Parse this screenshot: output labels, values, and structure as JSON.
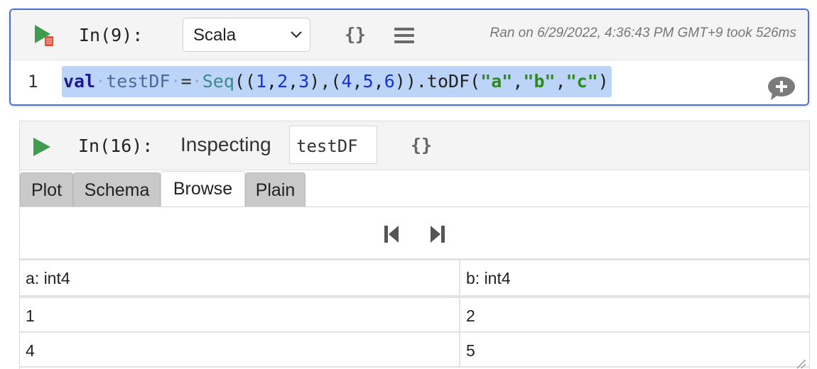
{
  "cell1": {
    "prompt": "In(9):",
    "language": "Scala",
    "braces": "{}",
    "run_info": "Ran on 6/29/2022, 4:36:43 PM GMT+9 took 526ms",
    "line_number": "1",
    "code_tokens": [
      {
        "t": "val",
        "c": "kw"
      },
      {
        "t": "·",
        "c": "ws"
      },
      {
        "t": "testDF",
        "c": "id"
      },
      {
        "t": "·",
        "c": "ws"
      },
      {
        "t": "=",
        "c": "op"
      },
      {
        "t": "·",
        "c": "ws"
      },
      {
        "t": "Seq",
        "c": "ty"
      },
      {
        "t": "((",
        "c": "p"
      },
      {
        "t": "1",
        "c": "num"
      },
      {
        "t": ",",
        "c": "p"
      },
      {
        "t": "2",
        "c": "num"
      },
      {
        "t": ",",
        "c": "p"
      },
      {
        "t": "3",
        "c": "num"
      },
      {
        "t": "),(",
        "c": "p"
      },
      {
        "t": "4",
        "c": "num"
      },
      {
        "t": ",",
        "c": "p"
      },
      {
        "t": "5",
        "c": "num"
      },
      {
        "t": ",",
        "c": "p"
      },
      {
        "t": "6",
        "c": "num"
      },
      {
        "t": ")).toDF(",
        "c": "p"
      },
      {
        "t": "\"a\"",
        "c": "str"
      },
      {
        "t": ",",
        "c": "p"
      },
      {
        "t": "\"b\"",
        "c": "str"
      },
      {
        "t": ",",
        "c": "p"
      },
      {
        "t": "\"c\"",
        "c": "str"
      },
      {
        "t": ")",
        "c": "p"
      }
    ]
  },
  "cell2": {
    "prompt": "In(16):",
    "inspect_label": "Inspecting",
    "inspect_value": "testDF",
    "braces": "{}",
    "tabs": [
      {
        "label": "Plot",
        "active": false
      },
      {
        "label": "Schema",
        "active": false
      },
      {
        "label": "Browse",
        "active": true
      },
      {
        "label": "Plain",
        "active": false
      }
    ],
    "table": {
      "headers": [
        "a: int4",
        "b: int4"
      ],
      "rows": [
        [
          "1",
          "2"
        ],
        [
          "4",
          "5"
        ]
      ]
    }
  },
  "icons": {
    "run": "run-play-icon",
    "run_error_badge": "error-badge-icon",
    "dropdown": "chevron-down-icon",
    "menu": "hamburger-menu-icon",
    "add_comment": "add-comment-icon",
    "first_page": "skip-to-first-icon",
    "last_page": "skip-to-last-icon",
    "resize": "resize-grip-icon"
  },
  "colors": {
    "accent_border": "#4f6fd8",
    "run_green": "#3f9c4f",
    "selection": "#bcd4f7",
    "string": "#2e8a1e",
    "number": "#1530d8",
    "keyword": "#1b1b8f"
  }
}
